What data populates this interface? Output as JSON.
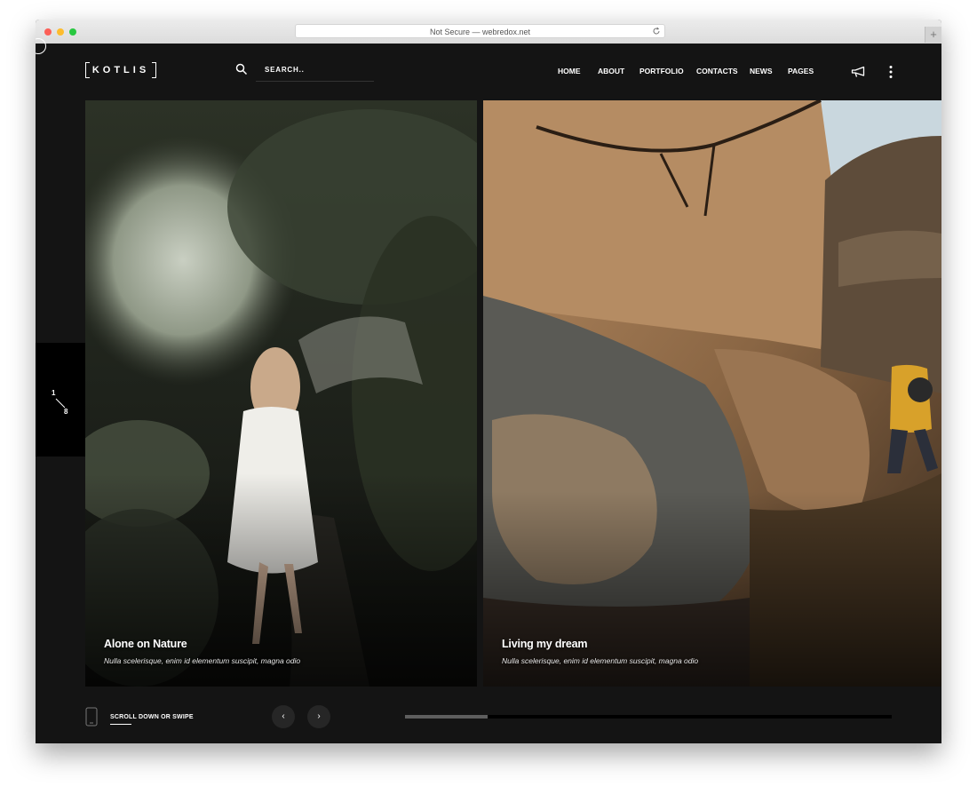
{
  "browser": {
    "address": "Not Secure — webredox.net",
    "new_tab": "+"
  },
  "header": {
    "logo_text": "KOTLIS",
    "search_placeholder": "SEARCH..",
    "nav": [
      {
        "label": "HOME"
      },
      {
        "label": "ABOUT"
      },
      {
        "label": "PORTFOLIO"
      },
      {
        "label": "CONTACTS"
      },
      {
        "label": "NEWS"
      },
      {
        "label": "PAGES"
      }
    ]
  },
  "slider": {
    "counter_current": "1",
    "counter_total": "8",
    "slides": [
      {
        "title": "Alone on Nature",
        "subtitle": "Nulla scelerisque, enim id elementum suscipit, magna odio"
      },
      {
        "title": "Living my dream",
        "subtitle": "Nulla scelerisque, enim id elementum suscipit, magna odio"
      }
    ],
    "progress": 0.17
  },
  "footer": {
    "scroll_hint": "SCROLL DOWN OR SWIPE",
    "prev_label": "‹",
    "next_label": "›"
  },
  "colors": {
    "background": "#141414",
    "counter_bg": "#000000",
    "text": "#ffffff",
    "progress_fill": "#5e5e5e"
  },
  "icons": {
    "search": "search-icon",
    "megaphone": "megaphone-icon",
    "more": "more-vertical-icon",
    "phone": "phone-icon",
    "reload": "reload-icon"
  }
}
